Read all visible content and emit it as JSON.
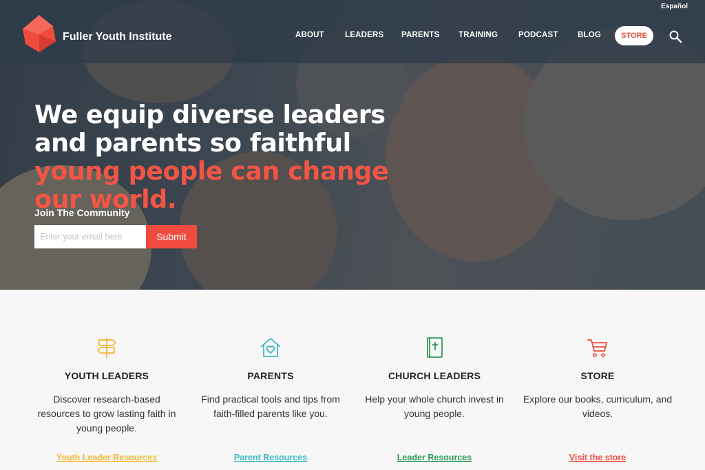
{
  "language_link": "Español",
  "brand": {
    "name": "Fuller Youth Institute",
    "color": "#ef4c3f"
  },
  "nav": {
    "items": [
      "ABOUT",
      "LEADERS",
      "PARENTS",
      "TRAINING",
      "PODCAST",
      "BLOG"
    ],
    "store": "STORE",
    "search_icon": "search-icon"
  },
  "hero": {
    "headline_white": "We equip diverse leaders and parents so faithful ",
    "headline_accent": "young people can change our world.",
    "accent_color": "#f25545",
    "join_label": "Join The Community",
    "email_placeholder": "Enter your email here",
    "submit_label": "Submit"
  },
  "cards": [
    {
      "icon": "signpost-icon",
      "color": "#f3b733",
      "title": "YOUTH LEADERS",
      "text": "Discover research-based resources to grow lasting faith in young people.",
      "link": "Youth Leader Resources"
    },
    {
      "icon": "house-heart-icon",
      "color": "#3ab8c4",
      "title": "PARENTS",
      "text": "Find practical tools and tips from faith-filled parents like you.",
      "link": "Parent Resources"
    },
    {
      "icon": "bible-icon",
      "color": "#2f9a55",
      "title": "CHURCH LEADERS",
      "text": "Help your whole church invest in young people.",
      "link": "Leader Resources"
    },
    {
      "icon": "cart-icon",
      "color": "#ef4c3f",
      "title": "STORE",
      "text": "Explore our books, curriculum, and videos.",
      "link": "Visit the store"
    }
  ]
}
